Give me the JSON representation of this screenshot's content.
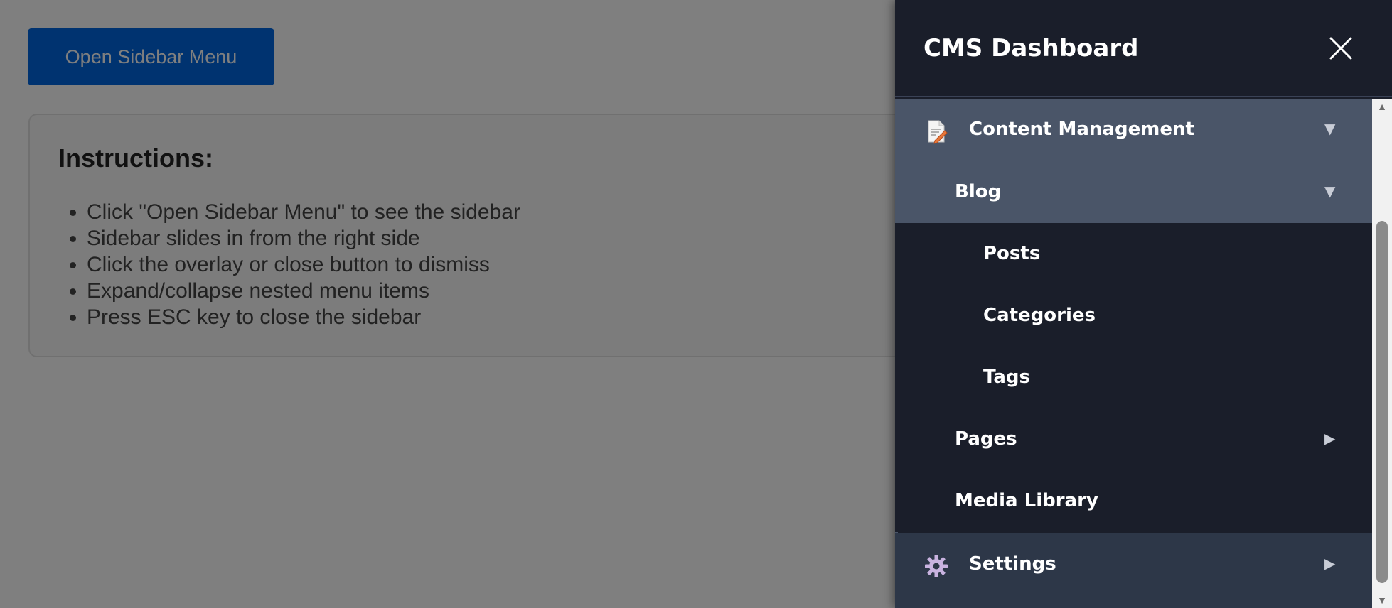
{
  "main": {
    "open_button_label": "Open Sidebar Menu",
    "instructions": {
      "title": "Instructions:",
      "items": [
        "Click \"Open Sidebar Menu\" to see the sidebar",
        "Sidebar slides in from the right side",
        "Click the overlay or close button to dismiss",
        "Expand/collapse nested menu items",
        "Press ESC key to close the sidebar"
      ]
    }
  },
  "sidebar": {
    "title": "CMS Dashboard",
    "close_icon": "close-icon",
    "menu": {
      "content_management": {
        "label": "Content Management",
        "icon": "document-edit-icon",
        "expanded": true
      },
      "blog": {
        "label": "Blog",
        "expanded": true
      },
      "posts": {
        "label": "Posts"
      },
      "categories": {
        "label": "Categories"
      },
      "tags": {
        "label": "Tags"
      },
      "pages": {
        "label": "Pages",
        "expanded": false
      },
      "media_library": {
        "label": "Media Library"
      },
      "settings": {
        "label": "Settings",
        "icon": "gear-icon",
        "expanded": false
      }
    },
    "arrow_down": "▼",
    "arrow_right": "▶"
  },
  "colors": {
    "primary_button": "#0066e0",
    "sidebar_bg": "#1a1e2a",
    "active_row": "#4a5568",
    "settings_row": "#2d3748"
  }
}
